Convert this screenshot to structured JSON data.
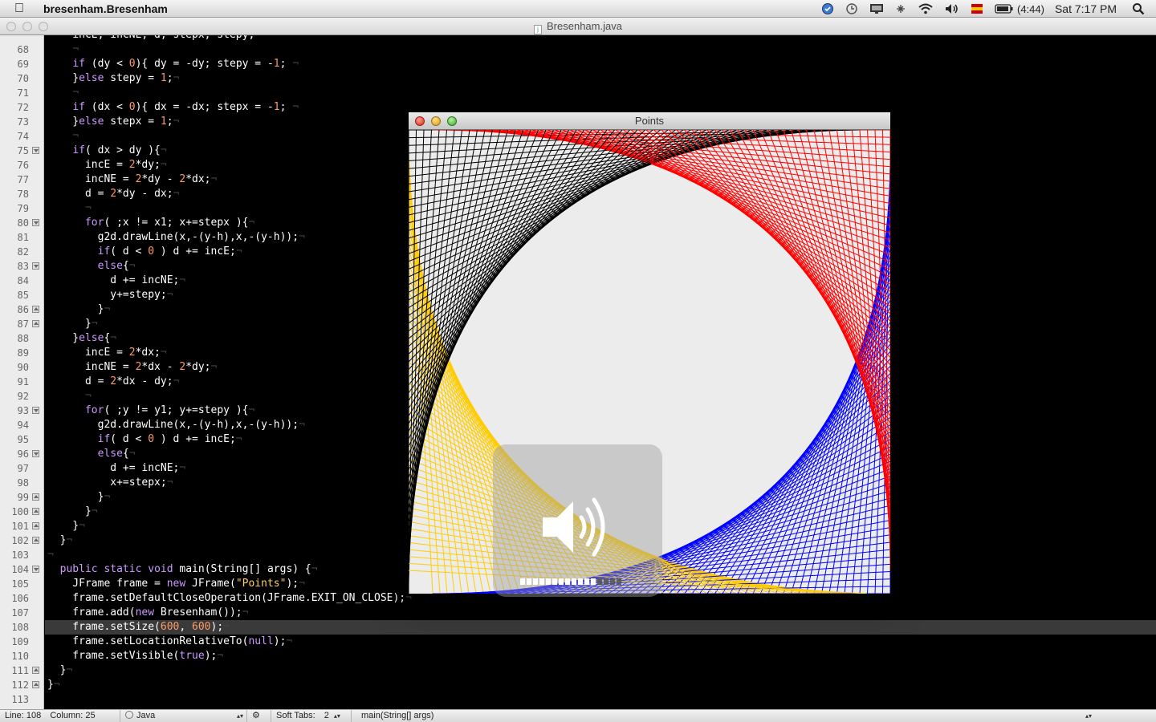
{
  "menubar": {
    "app_name": "bresenham.Bresenham",
    "battery": "(4:44)",
    "clock": "Sat 7:17 PM",
    "icons": [
      "apple-icon",
      "cloud-icon",
      "time-machine-icon",
      "display-icon",
      "bluetooth-icon",
      "wifi-icon",
      "volume-icon",
      "flag-icon",
      "battery-icon",
      "spotlight-icon"
    ]
  },
  "editor": {
    "file_title": "Bresenham.java",
    "current_line": 108,
    "lines": [
      {
        "n": "68",
        "fold": ""
      },
      {
        "n": "69",
        "fold": ""
      },
      {
        "n": "70",
        "fold": ""
      },
      {
        "n": "71",
        "fold": ""
      },
      {
        "n": "72",
        "fold": ""
      },
      {
        "n": "73",
        "fold": ""
      },
      {
        "n": "74",
        "fold": ""
      },
      {
        "n": "75",
        "fold": "down"
      },
      {
        "n": "76",
        "fold": ""
      },
      {
        "n": "77",
        "fold": ""
      },
      {
        "n": "78",
        "fold": ""
      },
      {
        "n": "79",
        "fold": ""
      },
      {
        "n": "80",
        "fold": "down"
      },
      {
        "n": "81",
        "fold": ""
      },
      {
        "n": "82",
        "fold": ""
      },
      {
        "n": "83",
        "fold": "down"
      },
      {
        "n": "84",
        "fold": ""
      },
      {
        "n": "85",
        "fold": ""
      },
      {
        "n": "86",
        "fold": "up"
      },
      {
        "n": "87",
        "fold": "up"
      },
      {
        "n": "88",
        "fold": ""
      },
      {
        "n": "89",
        "fold": ""
      },
      {
        "n": "90",
        "fold": ""
      },
      {
        "n": "91",
        "fold": ""
      },
      {
        "n": "92",
        "fold": ""
      },
      {
        "n": "93",
        "fold": "down"
      },
      {
        "n": "94",
        "fold": ""
      },
      {
        "n": "95",
        "fold": ""
      },
      {
        "n": "96",
        "fold": "down"
      },
      {
        "n": "97",
        "fold": ""
      },
      {
        "n": "98",
        "fold": ""
      },
      {
        "n": "99",
        "fold": "up"
      },
      {
        "n": "100",
        "fold": "up"
      },
      {
        "n": "101",
        "fold": "up"
      },
      {
        "n": "102",
        "fold": "up"
      },
      {
        "n": "103",
        "fold": ""
      },
      {
        "n": "104",
        "fold": "down"
      },
      {
        "n": "105",
        "fold": ""
      },
      {
        "n": "106",
        "fold": ""
      },
      {
        "n": "107",
        "fold": ""
      },
      {
        "n": "108",
        "fold": ""
      },
      {
        "n": "109",
        "fold": ""
      },
      {
        "n": "110",
        "fold": ""
      },
      {
        "n": "111",
        "fold": "up"
      },
      {
        "n": "112",
        "fold": "up"
      },
      {
        "n": "113",
        "fold": ""
      }
    ],
    "code": [
      "    incE, incNE, d, stepx, stepy;",
      "    ¬",
      "    if (dy < 0){ dy = -dy; stepy = -1; ¬",
      "    }else stepy = 1;¬",
      "    ¬",
      "    if (dx < 0){ dx = -dx; stepx = -1; ¬",
      "    }else stepx = 1;¬",
      "    ¬",
      "    if( dx > dy ){¬",
      "      incE = 2*dy;¬",
      "      incNE = 2*dy - 2*dx;¬",
      "      d = 2*dy - dx;¬",
      "      ¬",
      "      for( ;x != x1; x+=stepx ){¬",
      "        g2d.drawLine(x,-(y-h),x,-(y-h));¬",
      "        if( d < 0 ) d += incE;¬",
      "        else{¬",
      "          d += incNE;¬",
      "          y+=stepy;¬",
      "        }¬",
      "      }¬",
      "    }else{¬",
      "      incE = 2*dx;¬",
      "      incNE = 2*dx - 2*dy;¬",
      "      d = 2*dx - dy;¬",
      "      ¬",
      "      for( ;y != y1; y+=stepy ){¬",
      "        g2d.drawLine(x,-(y-h),x,-(y-h));¬",
      "        if( d < 0 ) d += incE;¬",
      "        else{¬",
      "          d += incNE;¬",
      "          x+=stepx;¬",
      "        }¬",
      "      }¬",
      "    }¬",
      "  }¬",
      "¬",
      "  public static void main(String[] args) {¬",
      "    JFrame frame = new JFrame(\"Points\");¬",
      "    frame.setDefaultCloseOperation(JFrame.EXIT_ON_CLOSE);¬",
      "    frame.add(new Bresenham());¬",
      "    frame.setSize(600, 600);¬",
      "    frame.setLocationRelativeTo(null);¬",
      "    frame.setVisible(true);¬",
      "  }¬",
      "}¬",
      ""
    ]
  },
  "statusbar": {
    "line": "Line: 108",
    "column": "Column: 25",
    "language": "Java",
    "soft_tabs_label": "Soft Tabs:",
    "soft_tabs_value": "2",
    "symbol": "main(String[] args)"
  },
  "points_window": {
    "title": "Points",
    "colors": {
      "black": "#000000",
      "red": "#ff0000",
      "blue": "#0000ff",
      "yellow": "#ffcc00",
      "background": "#ececec"
    }
  },
  "volume_hud": {
    "level": 0.75,
    "segments": 16
  }
}
